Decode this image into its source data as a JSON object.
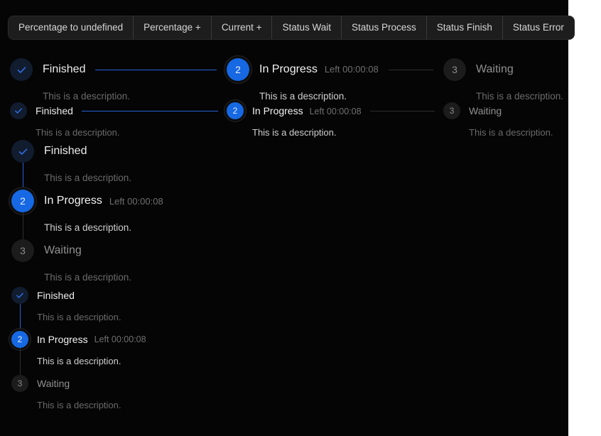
{
  "theme": {
    "page_background": "#ffffff",
    "app_background": "#050505",
    "accent": "#1668e3",
    "connector_active": "#2563d6",
    "connector_inactive": "#2e2e2e",
    "finish_circle_bg": "#111c2e",
    "finish_icon": "#2f6fe4",
    "wait_circle_bg": "#1c1c1c",
    "title_active": "#f3f3f3",
    "title_wait": "#8f8f8f",
    "description_dim": "#6a6a6a",
    "description_bright": "#cfcfcf"
  },
  "toolbar": {
    "buttons": [
      {
        "label": "Percentage to undefined"
      },
      {
        "label": "Percentage +"
      },
      {
        "label": "Current +"
      },
      {
        "label": "Status Wait"
      },
      {
        "label": "Status Process"
      },
      {
        "label": "Status Finish"
      },
      {
        "label": "Status Error"
      }
    ]
  },
  "steps": {
    "finish": {
      "title": "Finished",
      "description": "This is a description.",
      "icon": "check-icon",
      "status": "finish"
    },
    "process": {
      "title": "In Progress",
      "subtitle": "Left 00:00:08",
      "description": "This is a description.",
      "number": "2",
      "status": "process"
    },
    "wait": {
      "title": "Waiting",
      "description": "This is a description.",
      "number": "3",
      "status": "wait"
    }
  }
}
